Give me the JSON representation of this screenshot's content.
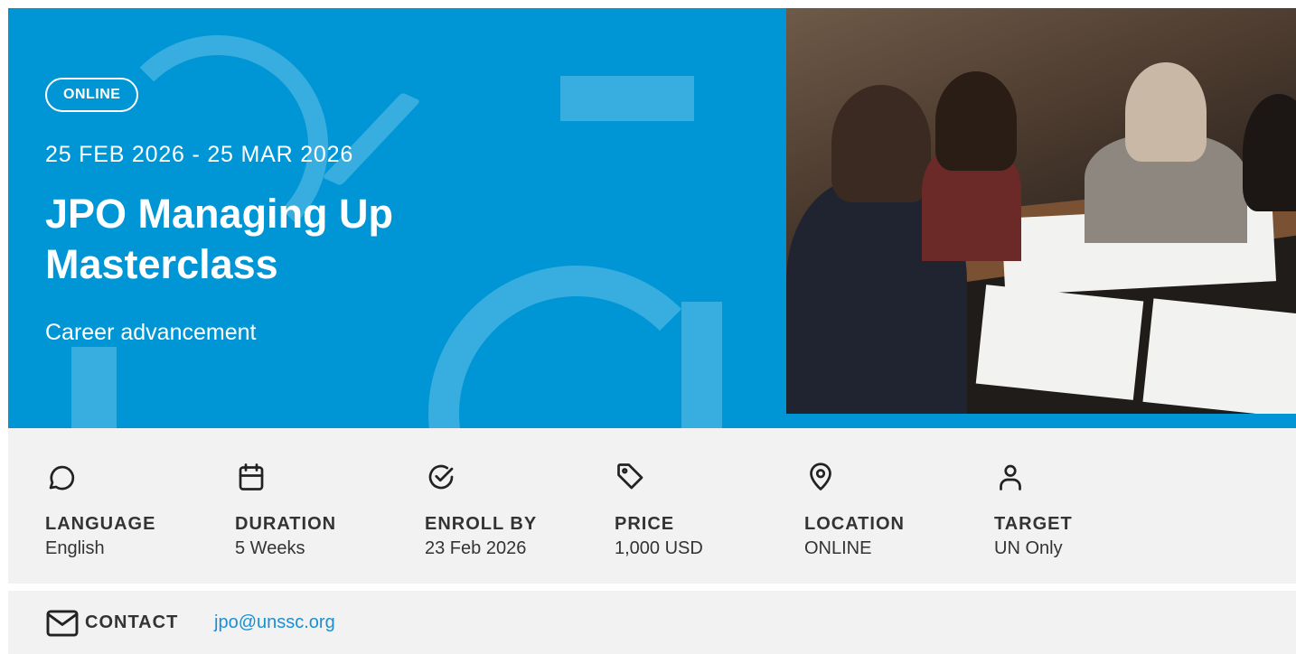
{
  "hero": {
    "badge": "ONLINE",
    "dates": "25 FEB 2026 - 25 MAR 2026",
    "title": "JPO Managing Up Masterclass",
    "subtitle": "Career advancement",
    "background_color": "#0096d6"
  },
  "details": [
    {
      "icon": "chat-bubble-icon",
      "label": "LANGUAGE",
      "value": "English"
    },
    {
      "icon": "calendar-icon",
      "label": "DURATION",
      "value": "5 Weeks"
    },
    {
      "icon": "check-circle-icon",
      "label": "ENROLL BY",
      "value": "23 Feb 2026"
    },
    {
      "icon": "price-tag-icon",
      "label": "PRICE",
      "value": "1,000 USD"
    },
    {
      "icon": "location-pin-icon",
      "label": "LOCATION",
      "value": "ONLINE"
    },
    {
      "icon": "user-icon",
      "label": "TARGET",
      "value": "UN Only"
    }
  ],
  "contact": {
    "icon": "envelope-icon",
    "label": "CONTACT",
    "email": "jpo@unssc.org",
    "link_color": "#1a8fd1"
  }
}
